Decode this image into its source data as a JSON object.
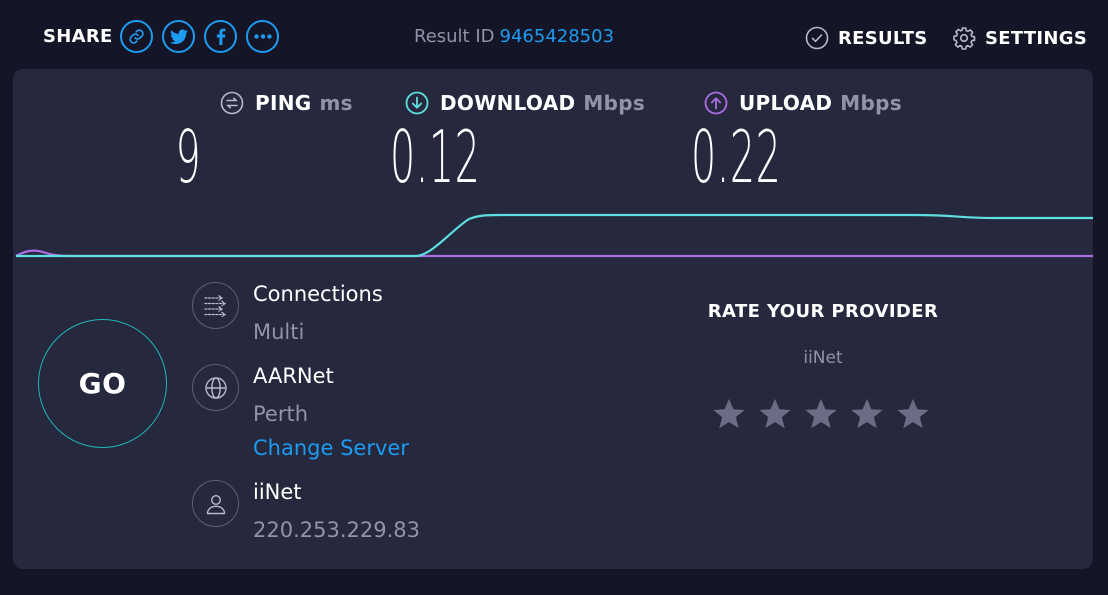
{
  "header": {
    "share_label": "SHARE",
    "share_icons": [
      "link-icon",
      "twitter-icon",
      "facebook-icon",
      "more-icon"
    ],
    "result_label": "Result ID",
    "result_id": "9465428503",
    "results_label": "RESULTS",
    "settings_label": "SETTINGS"
  },
  "metrics": {
    "ping": {
      "label": "PING",
      "unit": "ms",
      "value": "9",
      "icon": "ping-icon"
    },
    "download": {
      "label": "DOWNLOAD",
      "unit": "Mbps",
      "value": "0.12",
      "icon": "download-icon"
    },
    "upload": {
      "label": "UPLOAD",
      "unit": "Mbps",
      "value": "0.22",
      "icon": "upload-icon"
    }
  },
  "go_label": "GO",
  "connections": {
    "label": "Connections",
    "value": "Multi"
  },
  "server": {
    "name": "AARNet",
    "location": "Perth",
    "change_label": "Change Server"
  },
  "isp": {
    "name": "iiNet",
    "ip": "220.253.229.83"
  },
  "rate": {
    "title": "RATE YOUR PROVIDER",
    "provider": "iiNet",
    "rating": 0,
    "max_rating": 5
  },
  "colors": {
    "accent_blue": "#1d9bf0",
    "download_teal": "#5ee0e0",
    "upload_purple": "#a86ee0",
    "panel_bg": "#26283e",
    "page_bg": "#141526"
  }
}
